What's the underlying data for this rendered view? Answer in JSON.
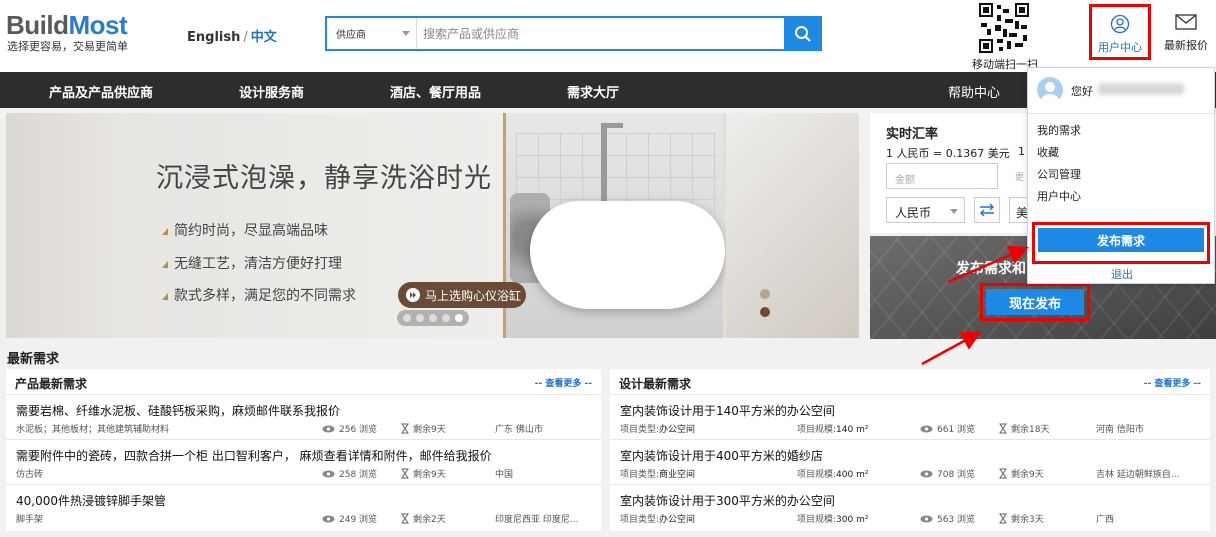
{
  "header": {
    "logo_part1": "Build",
    "logo_part2": "Most",
    "slogan": "选择更容易，交易更简单",
    "lang_en": "English",
    "lang_sep": "/",
    "lang_zh": "中文",
    "search": {
      "category": "供应商",
      "placeholder": "搜索产品或供应商"
    },
    "qr_label": "移动端扫一扫",
    "user_center": "用户中心",
    "latest_quote": "最新报价"
  },
  "nav": {
    "items": [
      "产品及产品供应商",
      "设计服务商",
      "酒店、餐厅用品",
      "需求大厅"
    ],
    "help": "帮助中心"
  },
  "banner": {
    "title": "沉浸式泡澡，静享洗浴时光",
    "points": [
      "简约时尚，尽显高端品味",
      "无缝工艺，清洁方便好打理",
      "款式多样，满足您的不同需求"
    ],
    "cta": "马上选购心仪浴缸"
  },
  "exchange": {
    "title": "实时汇率",
    "rate": "1 人民币 = 0.1367 美元",
    "rate2_partial": "1",
    "amount_placeholder": "金额",
    "more_partial": "更",
    "from_currency": "人民币",
    "to_currency_partial": "美"
  },
  "publish": {
    "text": "发布需求和",
    "now_button": "现在发布"
  },
  "user_dropdown": {
    "greeting": "您好",
    "items": [
      "我的需求",
      "收藏",
      "公司管理",
      "用户中心"
    ],
    "publish_button": "发布需求",
    "logout": "退出"
  },
  "latest": {
    "title": "最新需求",
    "products": {
      "title": "产品最新需求",
      "more": "-- 查看更多 --",
      "rows": [
        {
          "title": "需要岩棉、纤维水泥板、硅酸钙板采购，麻烦邮件联系我报价",
          "sub": "水泥板；其他板材；其他建筑辅助材料",
          "views": "256 浏览",
          "left": "剩余9天",
          "loc": "广东 佛山市"
        },
        {
          "title": "需要附件中的瓷砖，四款合拼一个柜 出口智利客户， 麻烦查看详情和附件，邮件给我报价",
          "sub": "仿古砖",
          "views": "258 浏览",
          "left": "剩余9天",
          "loc": "中国"
        },
        {
          "title": "40,000件热浸镀锌脚手架管",
          "sub": "脚手架",
          "views": "249 浏览",
          "left": "剩余2天",
          "loc": "印度尼西亚 印度尼..."
        }
      ]
    },
    "design": {
      "title": "设计最新需求",
      "more": "-- 查看更多 --",
      "type_label": "项目类型:",
      "scale_label": "项目规模:",
      "rows": [
        {
          "title": "室内装饰设计用于140平方米的办公空间",
          "type": "办公空间",
          "scale": "140 m²",
          "views": "661 浏览",
          "left": "剩余18天",
          "loc": "河南 信阳市"
        },
        {
          "title": "室内装饰设计用于400平方米的婚纱店",
          "type": "商业空间",
          "scale": "400 m²",
          "views": "708 浏览",
          "left": "剩余9天",
          "loc": "吉林 延边朝鲜族自..."
        },
        {
          "title": "室内装饰设计用于300平方米的办公空间",
          "type": "办公空间",
          "scale": "300 m²",
          "views": "563 浏览",
          "left": "剩余3天",
          "loc": "广西"
        }
      ]
    }
  },
  "colors": {
    "accent_blue": "#1e88e5",
    "highlight_red": "#e00000",
    "nav_dark": "#2d2d2d"
  }
}
